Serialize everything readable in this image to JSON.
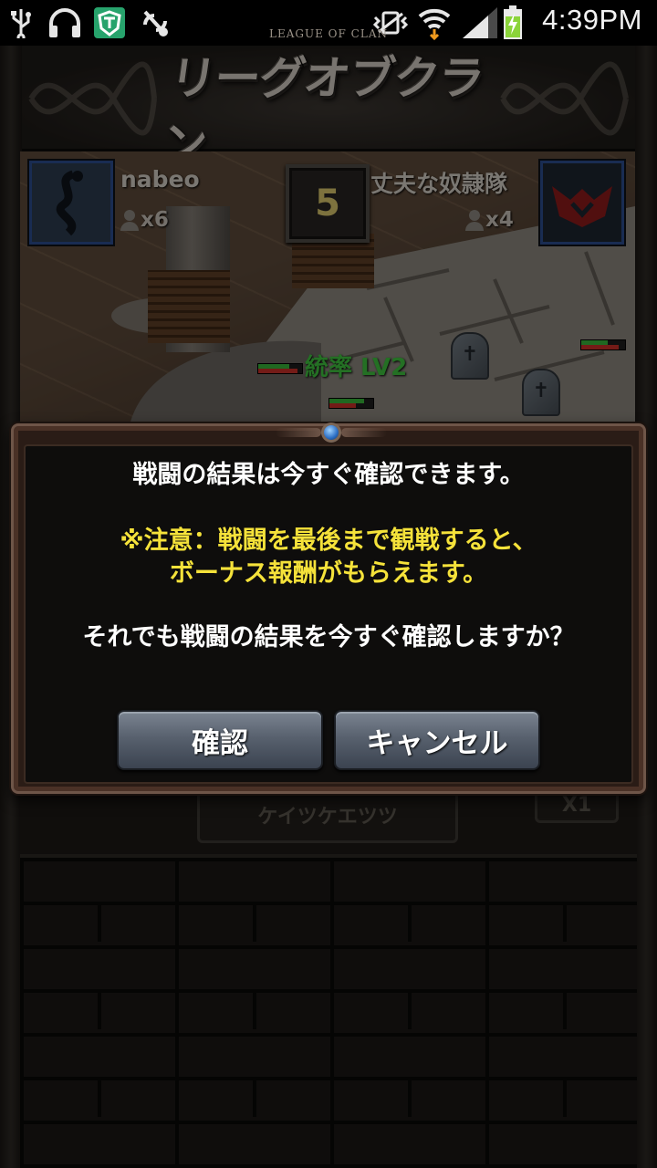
{
  "status_bar": {
    "time": "4:39PM",
    "icons": [
      "usb-icon",
      "headset-icon",
      "shield-app-icon",
      "sync-icon",
      "vibrate-icon",
      "wifi-icon",
      "signal-icon",
      "battery-charging-icon"
    ]
  },
  "header": {
    "subtitle": "LEAGUE OF CLAN",
    "title": "リーグオブクラン"
  },
  "battle": {
    "left_player": {
      "name": "nabeo",
      "members": "x6"
    },
    "right_player": {
      "name": "丈夫な奴隷隊",
      "members": "x4"
    },
    "round": "5",
    "skill_text": "統率 LV2"
  },
  "dialog": {
    "line1": "戦闘の結果は今すぐ確認できます。",
    "warning_line1": "※注意：戦闘を最後まで観戦すると、",
    "warning_line2": "ボーナス報酬がもらえます。",
    "question": "それでも戦闘の結果を今すぐ確認しますか？",
    "confirm_label": "確認",
    "cancel_label": "キャンセル"
  },
  "lower": {
    "button_text": "ケイツケエツツ",
    "badge_text": "X1"
  },
  "colors": {
    "warning_text": "#f5e23a",
    "button_top": "#7b8491",
    "skill_green": "#3fc23f"
  }
}
